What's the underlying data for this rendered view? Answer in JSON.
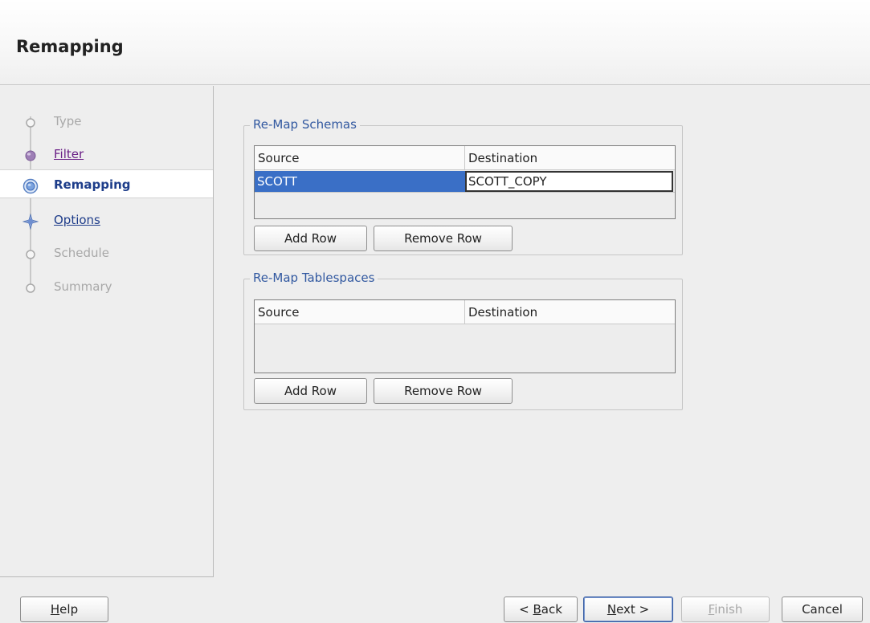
{
  "header": {
    "title": "Remapping"
  },
  "nav": {
    "items": [
      {
        "label": "Type",
        "state": "disabled"
      },
      {
        "label": "Filter",
        "state": "visited"
      },
      {
        "label": "Remapping",
        "state": "current"
      },
      {
        "label": "Options",
        "state": "link"
      },
      {
        "label": "Schedule",
        "state": "disabled"
      },
      {
        "label": "Summary",
        "state": "disabled"
      }
    ]
  },
  "schemas": {
    "title": "Re-Map Schemas",
    "columns": [
      "Source",
      "Destination"
    ],
    "rows": [
      {
        "source": "SCOTT",
        "destination": "SCOTT_COPY"
      }
    ],
    "add_row": "Add Row",
    "remove_row": "Remove Row"
  },
  "tablespaces": {
    "title": "Re-Map Tablespaces",
    "columns": [
      "Source",
      "Destination"
    ],
    "rows": [],
    "add_row": "Add Row",
    "remove_row": "Remove Row"
  },
  "footer": {
    "help": {
      "mnemonic": "H",
      "rest": "elp"
    },
    "back": {
      "prefix": "< ",
      "mnemonic": "B",
      "rest": "ack"
    },
    "next": {
      "mnemonic": "N",
      "rest": "ext >"
    },
    "finish": {
      "mnemonic": "F",
      "rest": "inish"
    },
    "cancel": "Cancel"
  },
  "colors": {
    "accent": "#3158a0",
    "selection": "#3a6fc6",
    "visited": "#6a1f86",
    "disabled": "#a8a8a8"
  },
  "icons": {
    "step_disabled": "hollow-circle-icon",
    "step_visited": "filled-circle-icon",
    "step_current": "target-circle-icon",
    "step_next": "star-circle-icon"
  }
}
